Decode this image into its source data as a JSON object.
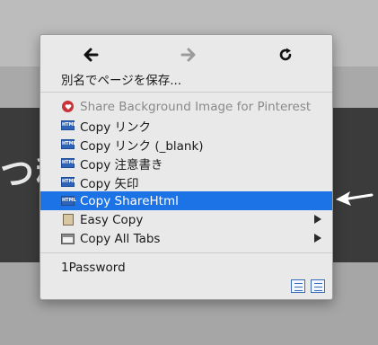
{
  "background": {
    "heading_fragment": "つ移"
  },
  "menu": {
    "nav": {
      "back_icon": "back-arrow-icon",
      "forward_icon": "forward-arrow-icon",
      "reload_icon": "reload-icon"
    },
    "save_page_label": "別名でページを保存...",
    "items": [
      {
        "label": "Share Background Image for Pinterest",
        "icon": "pinterest-icon",
        "disabled": true
      },
      {
        "label": "Copy リンク",
        "icon": "html-icon"
      },
      {
        "label": "Copy リンク (_blank)",
        "icon": "html-icon"
      },
      {
        "label": "Copy 注意書き",
        "icon": "html-icon"
      },
      {
        "label": "Copy 矢印",
        "icon": "html-icon"
      },
      {
        "label": "Copy ShareHtml",
        "icon": "html-icon",
        "selected": true
      },
      {
        "label": "Easy Copy",
        "icon": "easy-copy-icon",
        "submenu": true
      },
      {
        "label": "Copy All Tabs",
        "icon": "tabs-icon",
        "submenu": true
      }
    ],
    "onepassword_label": "1Password",
    "footer_icons": [
      "checklist-icon",
      "list-icon"
    ]
  },
  "colors": {
    "selection": "#1b73e6",
    "pinterest": "#c8323a",
    "html_icon": "#2f63b8"
  }
}
